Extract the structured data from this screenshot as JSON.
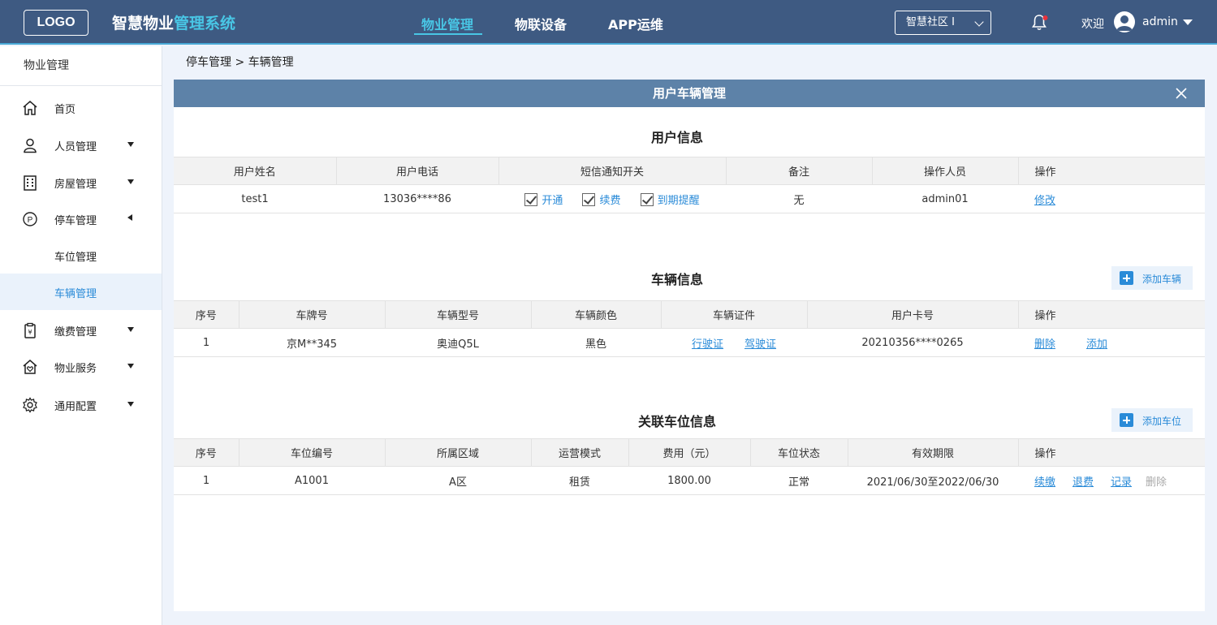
{
  "header": {
    "logo": "LOGO",
    "title_prefix": "智慧物业",
    "title_highlight": "管理系统",
    "nav": [
      {
        "label": "物业管理",
        "active": true
      },
      {
        "label": "物联设备",
        "active": false
      },
      {
        "label": "APP运维",
        "active": false
      }
    ],
    "community": "智慧社区 I",
    "welcome": "欢迎",
    "username": "admin",
    "accent_color": "#49c6e5",
    "bg_color": "#3e5a82"
  },
  "sidebar": {
    "heading": "物业管理",
    "items": [
      {
        "label": "首页",
        "icon": "home-icon"
      },
      {
        "label": "人员管理",
        "icon": "person-icon"
      },
      {
        "label": "房屋管理",
        "icon": "building-icon"
      },
      {
        "label": "停车管理",
        "icon": "parking-icon"
      },
      {
        "label": "车位管理",
        "icon": ""
      },
      {
        "label": "车辆管理",
        "icon": "",
        "active": true
      },
      {
        "label": "缴费管理",
        "icon": "billing-icon"
      },
      {
        "label": "物业服务",
        "icon": "service-house-icon"
      },
      {
        "label": "通用配置",
        "icon": "gear-icon"
      }
    ]
  },
  "breadcrumb": "停车管理 > 车辆管理",
  "panel": {
    "title": "用户车辆管理",
    "user_section": {
      "title": "用户信息",
      "columns": [
        "用户姓名",
        "用户电话",
        "短信通知开关",
        "备注",
        "操作人员",
        "操作"
      ],
      "row": {
        "name": "test1",
        "phone": "13036****86",
        "sms_options": [
          "开通",
          "续费",
          "到期提醒"
        ],
        "remark": "无",
        "operator": "admin01",
        "action": "修改"
      }
    },
    "vehicle_section": {
      "title": "车辆信息",
      "add_button": "添加车辆",
      "columns": [
        "序号",
        "车牌号",
        "车辆型号",
        "车辆颜色",
        "车辆证件",
        "用户卡号",
        "操作"
      ],
      "row": {
        "index": "1",
        "plate": "京M**345",
        "model": "奥迪Q5L",
        "color": "黑色",
        "doc1": "行驶证",
        "doc2": "驾驶证",
        "card": "20210356****0265",
        "op1": "删除",
        "op2": "添加"
      }
    },
    "space_section": {
      "title": "关联车位信息",
      "add_button": "添加车位",
      "columns": [
        "序号",
        "车位编号",
        "所属区域",
        "运营模式",
        "费用（元）",
        "车位状态",
        "有效期限",
        "操作"
      ],
      "row": {
        "index": "1",
        "code": "A1001",
        "area": "A区",
        "mode": "租赁",
        "fee": "1800.00",
        "status": "正常",
        "period": "2021/06/30至2022/06/30",
        "op1": "续缴",
        "op2": "退费",
        "op3": "记录",
        "op4": "删除"
      }
    },
    "link_color": "#2a8bd8"
  }
}
